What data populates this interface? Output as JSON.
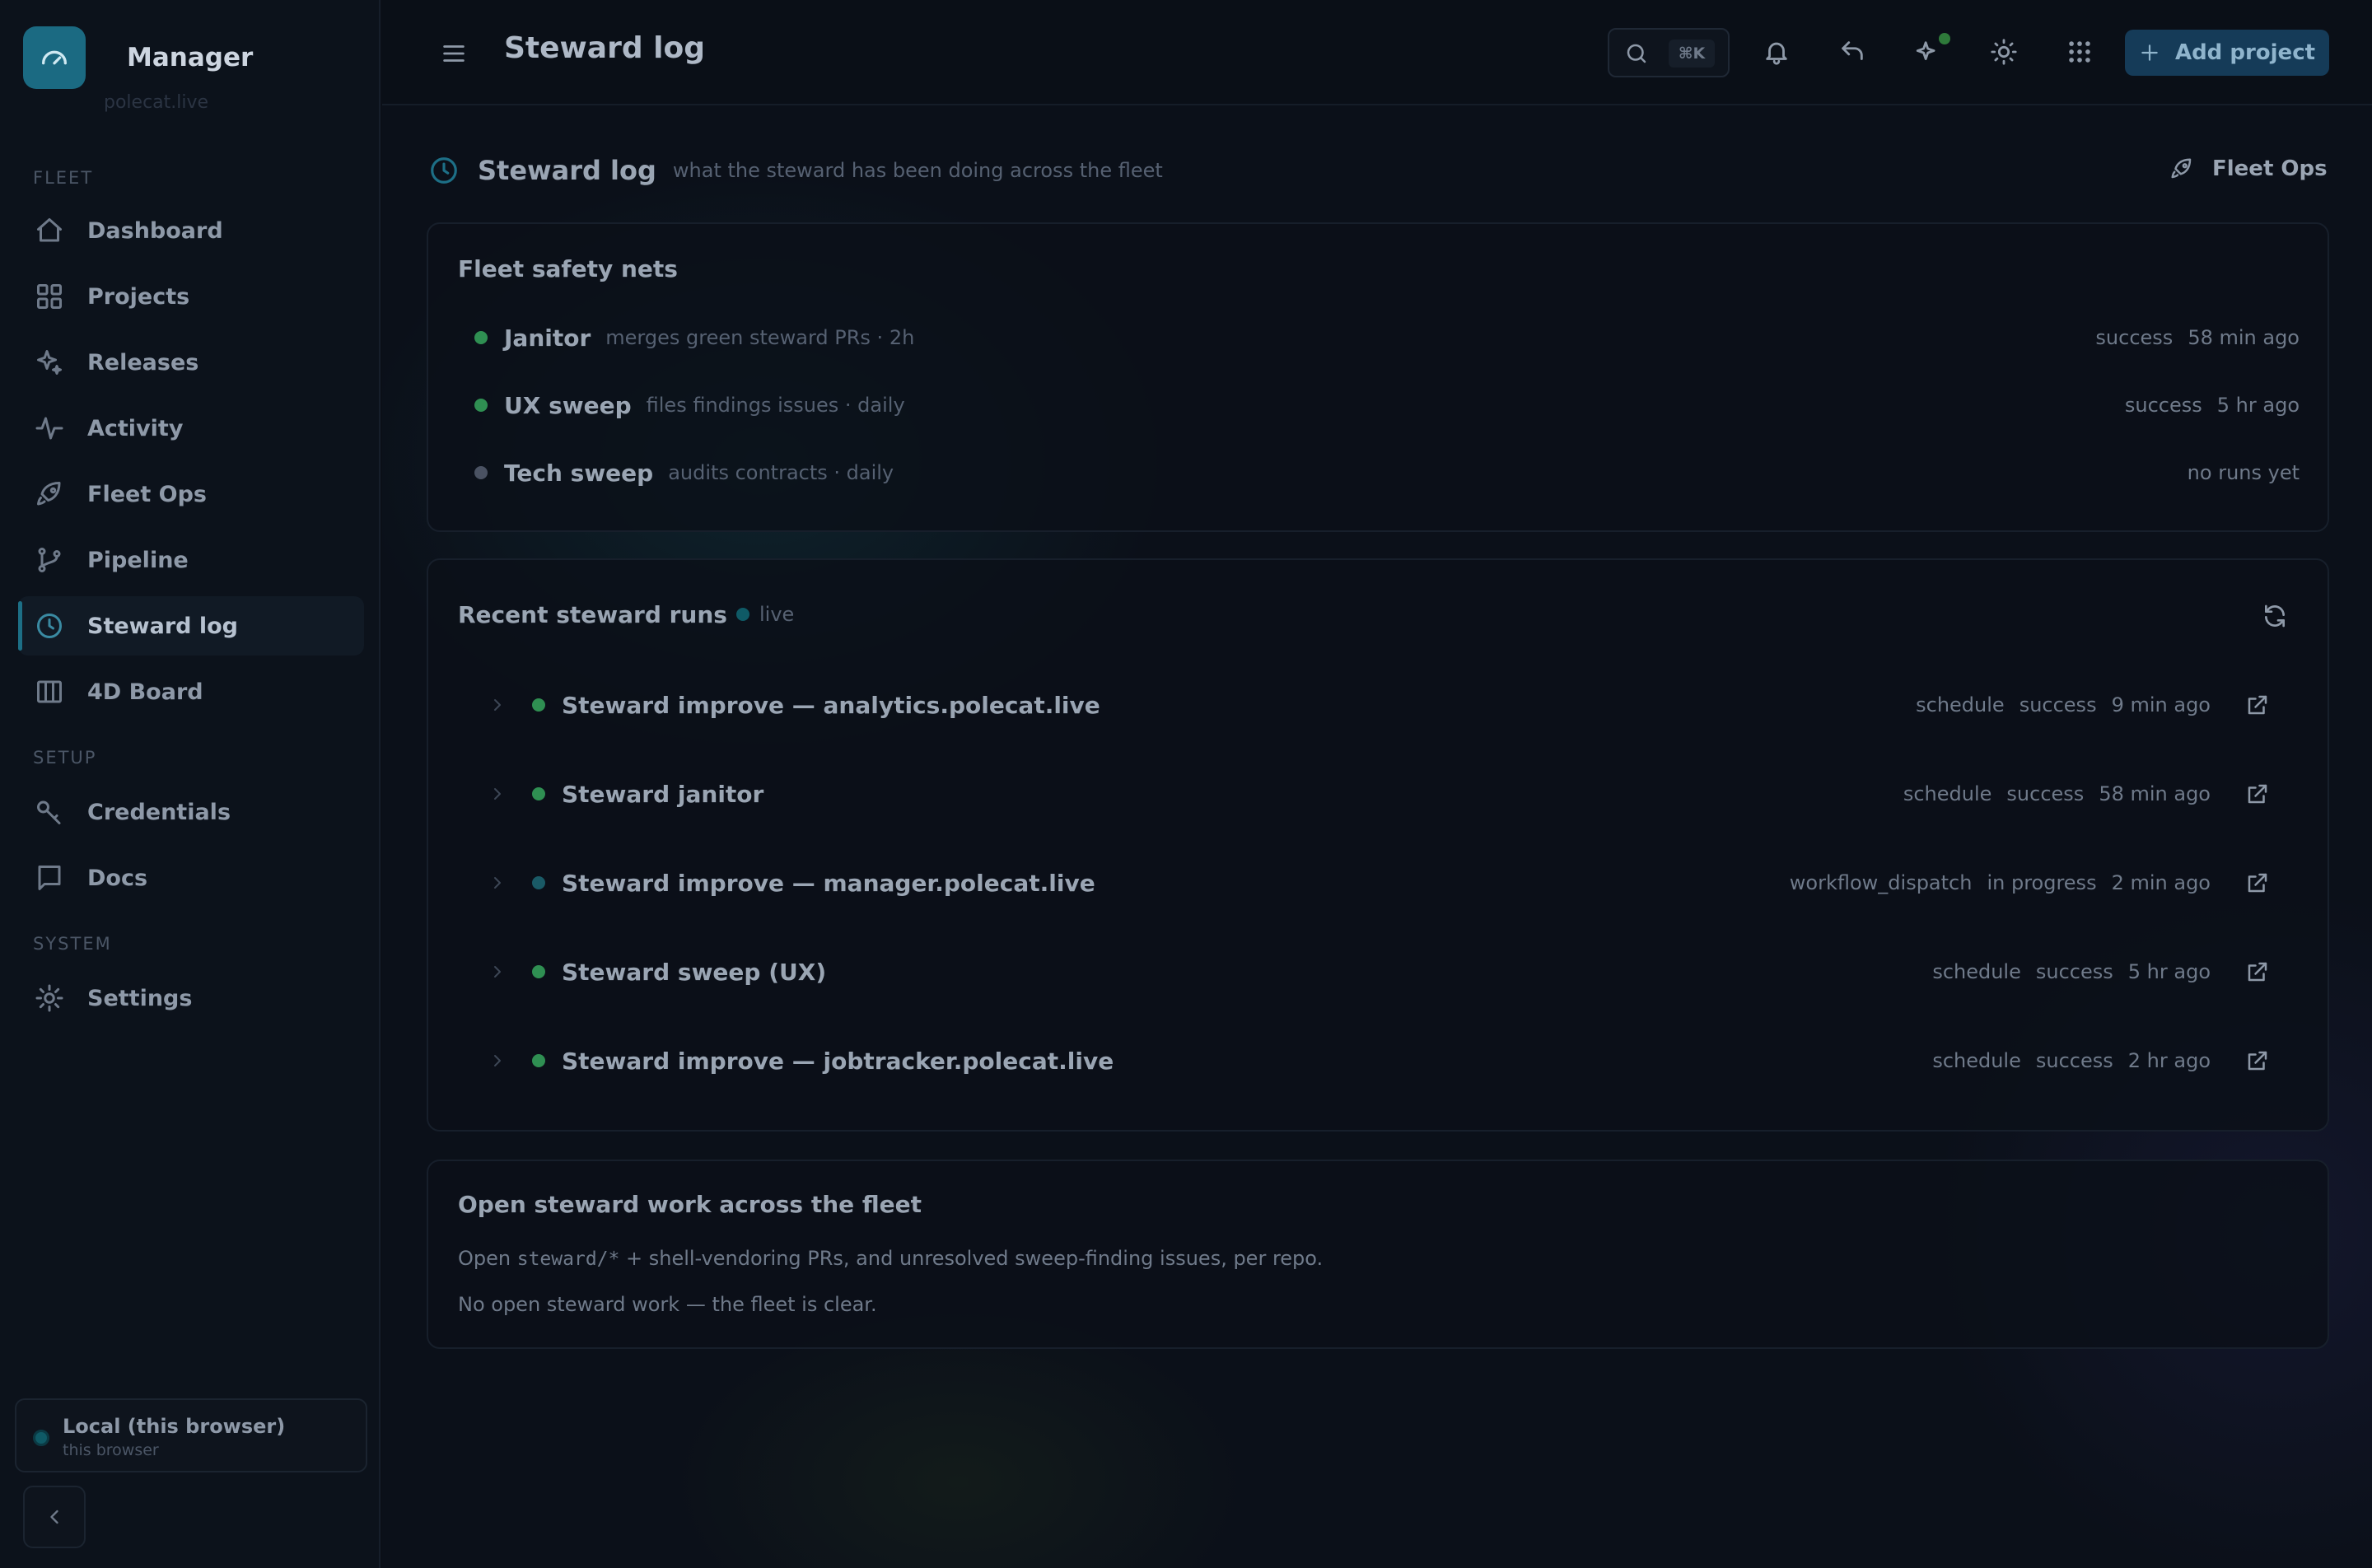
{
  "app": {
    "name": "Manager",
    "subtitle": "polecat.live"
  },
  "sidebar": {
    "sections": {
      "fleet": "FLEET",
      "setup": "SETUP",
      "system": "SYSTEM"
    },
    "items": [
      {
        "label": "Dashboard",
        "icon": "home-icon"
      },
      {
        "label": "Projects",
        "icon": "grid-icon"
      },
      {
        "label": "Releases",
        "icon": "sparkles-icon"
      },
      {
        "label": "Activity",
        "icon": "activity-icon"
      },
      {
        "label": "Fleet Ops",
        "icon": "rocket-icon"
      },
      {
        "label": "Pipeline",
        "icon": "git-branch-icon"
      },
      {
        "label": "Steward log",
        "icon": "clock-icon",
        "active": true
      },
      {
        "label": "4D Board",
        "icon": "columns-icon"
      },
      {
        "label": "Credentials",
        "icon": "key-icon"
      },
      {
        "label": "Docs",
        "icon": "message-square-icon"
      },
      {
        "label": "Settings",
        "icon": "gear-icon"
      }
    ],
    "workspace": {
      "name": "Local (this browser)",
      "sub": "this browser"
    }
  },
  "topbar": {
    "title": "Steward log",
    "search_shortcut": "⌘K",
    "add_project_label": "Add project"
  },
  "header": {
    "title": "Steward log",
    "subtitle": "what the steward has been doing across the fleet",
    "link_label": "Fleet Ops"
  },
  "safety_nets": {
    "title": "Fleet safety nets",
    "items": [
      {
        "name": "Janitor",
        "desc": "merges green steward PRs · 2h",
        "status": "success",
        "time": "58 min ago",
        "dot": "#2f8f52"
      },
      {
        "name": "UX sweep",
        "desc": "files findings issues · daily",
        "status": "success",
        "time": "5 hr ago",
        "dot": "#2f8f52"
      },
      {
        "name": "Tech sweep",
        "desc": "audits contracts · daily",
        "status": "",
        "time": "no runs yet",
        "dot": "#4a5262"
      }
    ]
  },
  "runs": {
    "title": "Recent steward runs",
    "live_label": "live",
    "items": [
      {
        "title": "Steward improve — analytics.polecat.live",
        "trigger": "schedule",
        "status": "success",
        "time": "9 min ago",
        "dot": "#2f8f52"
      },
      {
        "title": "Steward janitor",
        "trigger": "schedule",
        "status": "success",
        "time": "58 min ago",
        "dot": "#2f8f52"
      },
      {
        "title": "Steward improve — manager.polecat.live",
        "trigger": "workflow_dispatch",
        "status": "in progress",
        "time": "2 min ago",
        "dot": "#1a5a66"
      },
      {
        "title": "Steward sweep (UX)",
        "trigger": "schedule",
        "status": "success",
        "time": "5 hr ago",
        "dot": "#2f8f52"
      },
      {
        "title": "Steward improve — jobtracker.polecat.live",
        "trigger": "schedule",
        "status": "success",
        "time": "2 hr ago",
        "dot": "#2f8f52"
      }
    ]
  },
  "open_work": {
    "title": "Open steward work across the fleet",
    "desc_prefix": "Open ",
    "desc_code": "steward/*",
    "desc_suffix": " + shell-vendoring PRs, and unresolved sweep-finding issues, per repo.",
    "empty": "No open steward work — the fleet is clear."
  },
  "colors": {
    "accent": "#1d6f86",
    "success": "#2f8f52",
    "brand_button": "#153b58"
  }
}
